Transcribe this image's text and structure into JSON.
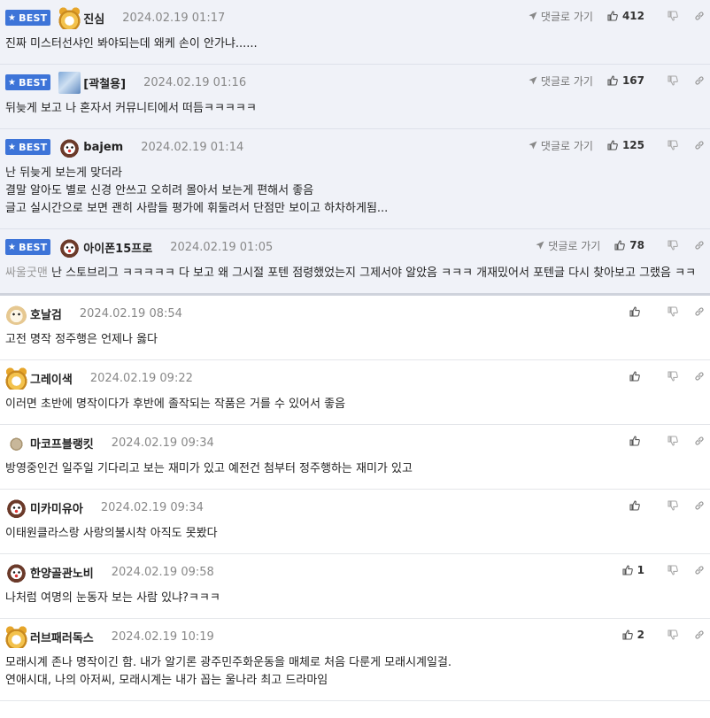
{
  "reply_label": "댓글로 가기",
  "best_label": "BEST",
  "comments": [
    {
      "best": true,
      "nick": "진심",
      "date": "2024.02.19 01:17",
      "likes": "412",
      "avatar": "fox",
      "text": "진짜 미스터선샤인 봐야되는데 왜케 손이 안가냐......"
    },
    {
      "best": true,
      "nick": "[곽철용]",
      "date": "2024.02.19 01:16",
      "likes": "167",
      "avatar": "photo",
      "text": "뒤늦게 보고 나 혼자서 커뮤니티에서 떠듬ㅋㅋㅋㅋㅋ"
    },
    {
      "best": true,
      "nick": "bajem",
      "date": "2024.02.19 01:14",
      "likes": "125",
      "avatar": "dog",
      "text": "난 뒤늦게 보는게 맞더라\n결말 알아도 별로 신경 안쓰고 오히려 몰아서 보는게 편해서 좋음\n글고 실시간으로 보면 괜히 사람들 평가에 휘둘려서 단점만 보이고 하차하게됨..."
    },
    {
      "best": true,
      "nick": "아이폰15프로",
      "date": "2024.02.19 01:05",
      "likes": "78",
      "avatar": "dog",
      "quote": "싸울굿맨",
      "text": "난 스토브리그 ㅋㅋㅋㅋㅋ 다 보고 왜 그시절 포텐 점령했었는지 그제서야 알았음 ㅋㅋㅋ 개재밌어서 포텐글 다시 찾아보고 그랬음 ㅋㅋ"
    },
    {
      "best": false,
      "nick": "호날검",
      "date": "2024.02.19 08:54",
      "likes": "",
      "avatar": "puppy",
      "text": "고전 명작 정주행은 언제나 옳다"
    },
    {
      "best": false,
      "nick": "그레이색",
      "date": "2024.02.19 09:22",
      "likes": "",
      "avatar": "fox",
      "text": "이러면 초반에 명작이다가 후반에 졸작되는 작품은 거를 수 있어서 좋음"
    },
    {
      "best": false,
      "nick": "마코프블랭킷",
      "date": "2024.02.19 09:34",
      "likes": "",
      "avatar": "dot",
      "text": "방영중인건 일주일 기다리고 보는 재미가 있고 예전건 첨부터 정주행하는 재미가 있고"
    },
    {
      "best": false,
      "nick": "미카미유아",
      "date": "2024.02.19 09:34",
      "likes": "",
      "avatar": "dog",
      "text": "이태원클라스랑 사랑의불시착 아직도 못봤다"
    },
    {
      "best": false,
      "nick": "한양골관노비",
      "date": "2024.02.19 09:58",
      "likes": "1",
      "avatar": "dog",
      "text": "나처럼 여명의 눈동자 보는 사람 있냐?ㅋㅋㅋ"
    },
    {
      "best": false,
      "nick": "러브패러독스",
      "date": "2024.02.19 10:19",
      "likes": "2",
      "avatar": "fox",
      "text": "모래시계 존나 명작이긴 함. 내가 알기론 광주민주화운동을 매체로 처음 다룬게 모래시계일걸.\n연애시대, 나의 아저씨, 모래시계는 내가 꼽는 울나라 최고 드라마임"
    }
  ]
}
